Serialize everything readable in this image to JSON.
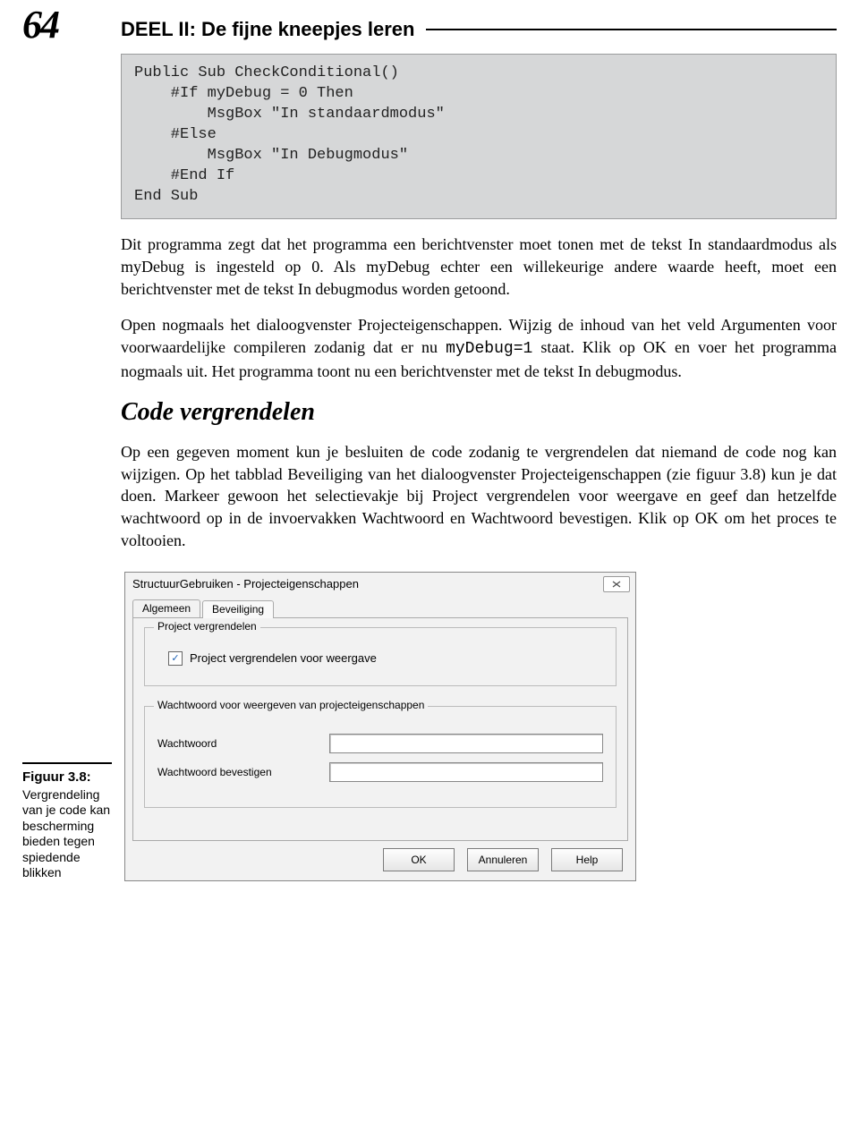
{
  "page_number": "64",
  "running_head": "DEEL II: De fijne kneepjes leren",
  "code_block": "Public Sub CheckConditional()\n    #If myDebug = 0 Then\n        MsgBox \"In standaardmodus\"\n    #Else\n        MsgBox \"In Debugmodus\"\n    #End If\nEnd Sub",
  "para1": "Dit programma zegt dat het programma een berichtvenster moet tonen met de tekst In standaardmodus als myDebug is ingesteld op 0. Als myDebug echter een willekeurige andere waarde heeft, moet een berichtvenster met de tekst In debugmodus worden getoond.",
  "para2_a": "Open nogmaals het dialoogvenster Projecteigenschappen. Wijzig de inhoud van het veld Argumenten voor voorwaardelijke compileren zodanig dat er nu ",
  "para2_code": "myDebug=1",
  "para2_b": " staat. Klik op OK en voer het programma nogmaals uit. Het programma toont nu een berichtvenster met de tekst In debugmodus.",
  "heading": "Code vergrendelen",
  "para3": "Op een gegeven moment kun je besluiten de code zodanig te vergrendelen dat niemand de code nog kan wijzigen. Op het tabblad Beveiliging van het dialoogvenster Projecteigenschappen (zie figuur 3.8) kun je dat doen. Markeer gewoon het selectievakje bij Project vergrendelen voor weergave en geef dan hetzelfde wachtwoord op in de invoervakken Wachtwoord en Wachtwoord bevestigen. Klik op OK om het proces te voltooien.",
  "figure": {
    "label": "Figuur 3.8:",
    "caption": "Vergrendeling van je code kan bescherming bieden tegen spiedende blikken"
  },
  "dialog": {
    "title": "StructuurGebruiken - Projecteigenschappen",
    "tabs": {
      "general": "Algemeen",
      "security": "Beveiliging"
    },
    "group_lock": "Project vergrendelen",
    "checkbox_label": "Project vergrendelen voor weergave",
    "checkbox_checked": "✓",
    "group_pwd": "Wachtwoord voor weergeven van projecteigenschappen",
    "field_pwd": "Wachtwoord",
    "field_pwd2": "Wachtwoord bevestigen",
    "buttons": {
      "ok": "OK",
      "cancel": "Annuleren",
      "help": "Help"
    }
  }
}
